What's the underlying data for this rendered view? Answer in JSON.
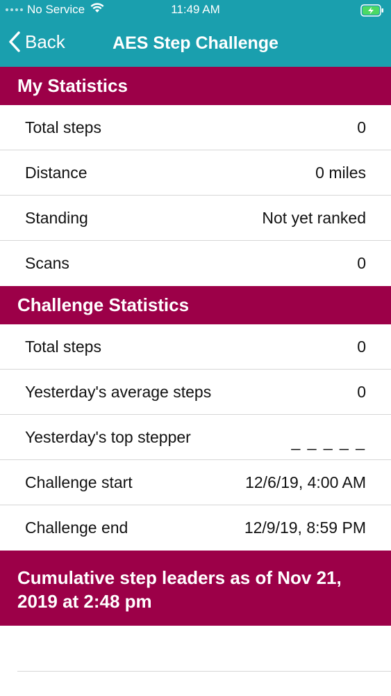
{
  "status_bar": {
    "carrier": "No Service",
    "time": "11:49 AM"
  },
  "nav": {
    "back_label": "Back",
    "title": "AES Step Challenge"
  },
  "my_statistics": {
    "header": "My Statistics",
    "rows": [
      {
        "label": "Total steps",
        "value": "0"
      },
      {
        "label": "Distance",
        "value": "0 miles"
      },
      {
        "label": "Standing",
        "value": "Not yet ranked"
      },
      {
        "label": "Scans",
        "value": "0"
      }
    ]
  },
  "challenge_statistics": {
    "header": "Challenge Statistics",
    "rows": [
      {
        "label": "Total steps",
        "value": "0"
      },
      {
        "label": "Yesterday's average steps",
        "value": "0"
      },
      {
        "label": "Yesterday's top stepper",
        "value": "_ _ _ _ _"
      },
      {
        "label": "Challenge start",
        "value": "12/6/19, 4:00 AM"
      },
      {
        "label": "Challenge end",
        "value": "12/9/19, 8:59 PM"
      }
    ]
  },
  "leaders": {
    "header": "Cumulative step leaders as of Nov 21, 2019 at 2:48 pm"
  },
  "colors": {
    "nav_bg": "#1a9fae",
    "section_bg": "#9c0048",
    "battery_green": "#4cd964"
  }
}
